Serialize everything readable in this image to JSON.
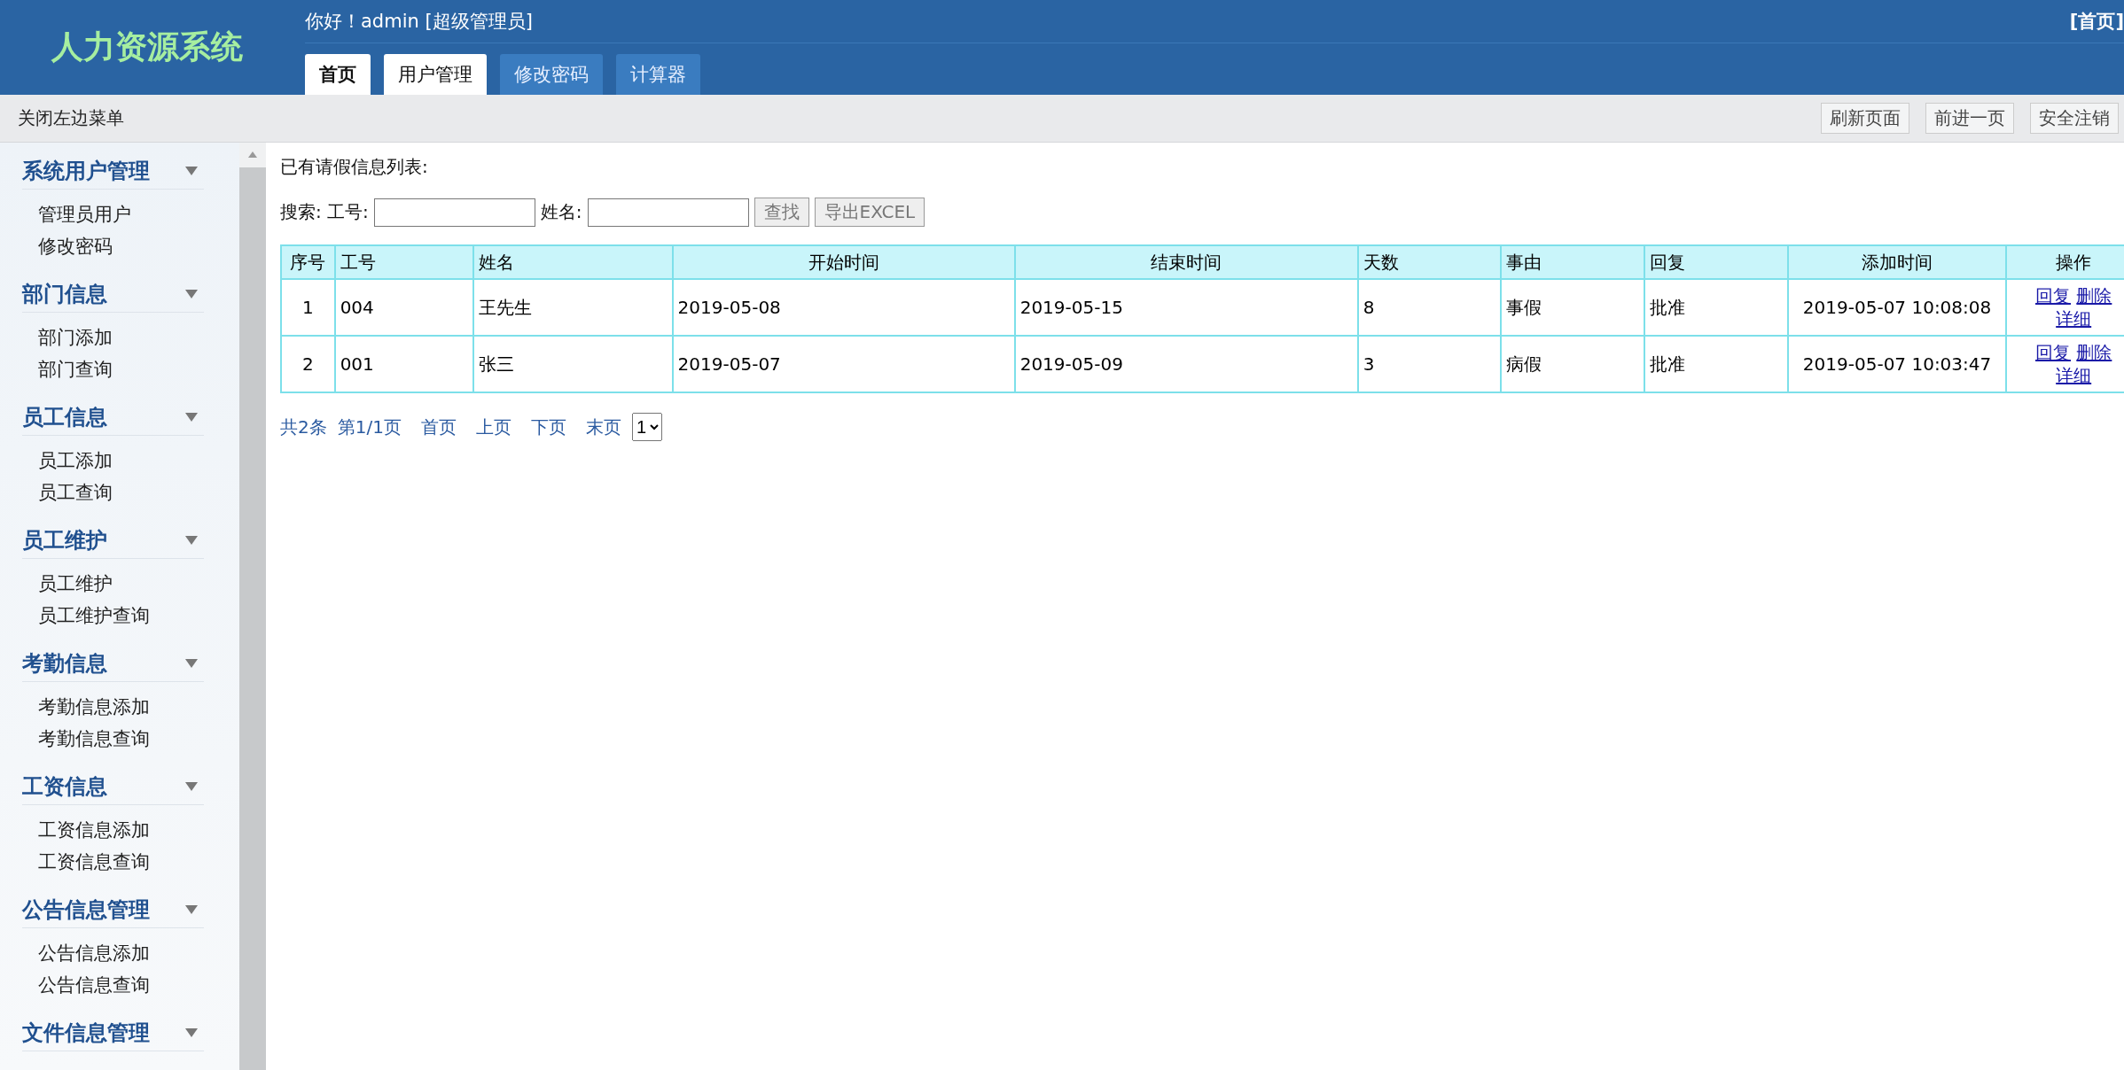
{
  "header": {
    "title": "人力资源系统",
    "greeting": "你好！admin [超级管理员]",
    "home_link": "[首页]",
    "tabs": [
      {
        "label": "首页",
        "selected": true,
        "hovered": false
      },
      {
        "label": "用户管理",
        "selected": false,
        "hovered": true
      },
      {
        "label": "修改密码",
        "selected": false,
        "hovered": false
      },
      {
        "label": "计算器",
        "selected": false,
        "hovered": false
      }
    ]
  },
  "toolbar": {
    "toggle": "关闭左边菜单",
    "buttons": [
      "刷新页面",
      "前进一页",
      "安全注销"
    ]
  },
  "sidebar": {
    "groups": [
      {
        "title": "系统用户管理",
        "expanded": true,
        "children": [
          "管理员用户",
          "修改密码"
        ]
      },
      {
        "title": "部门信息",
        "expanded": true,
        "children": [
          "部门添加",
          "部门查询"
        ]
      },
      {
        "title": "员工信息",
        "expanded": true,
        "children": [
          "员工添加",
          "员工查询"
        ]
      },
      {
        "title": "员工维护",
        "expanded": true,
        "children": [
          "员工维护",
          "员工维护查询"
        ]
      },
      {
        "title": "考勤信息",
        "expanded": true,
        "children": [
          "考勤信息添加",
          "考勤信息查询"
        ]
      },
      {
        "title": "工资信息",
        "expanded": true,
        "children": [
          "工资信息添加",
          "工资信息查询"
        ]
      },
      {
        "title": "公告信息管理",
        "expanded": true,
        "children": [
          "公告信息添加",
          "公告信息查询"
        ]
      },
      {
        "title": "文件信息管理",
        "expanded": true
      }
    ]
  },
  "main": {
    "heading": "已有请假信息列表:",
    "search": {
      "label": "搜索: 工号:",
      "name_label": "姓名:",
      "buttons": [
        "查找",
        "导出EXCEL"
      ]
    },
    "table": {
      "columns": [
        "序号",
        "工号",
        "姓名",
        "开始时间",
        "结束时间",
        "天数",
        "事由",
        "回复",
        "添加时间",
        "操作"
      ],
      "rows": [
        {
          "cells": [
            "1",
            "004",
            "王先生",
            "2019-05-08",
            "2019-05-15",
            "8",
            "事假",
            "批准",
            "2019-05-07 10:08:08"
          ],
          "actions": [
            "回复",
            "删除",
            "详细"
          ]
        },
        {
          "cells": [
            "2",
            "001",
            "张三",
            "2019-05-07",
            "2019-05-09",
            "3",
            "病假",
            "批准",
            "2019-05-07 10:03:47"
          ],
          "actions": [
            "回复",
            "删除",
            "详细"
          ]
        }
      ]
    },
    "pagination": {
      "total": "共2条",
      "page": "第1/1页",
      "links": [
        "首页",
        "上页",
        "下页",
        "末页"
      ],
      "select": "1"
    }
  }
}
